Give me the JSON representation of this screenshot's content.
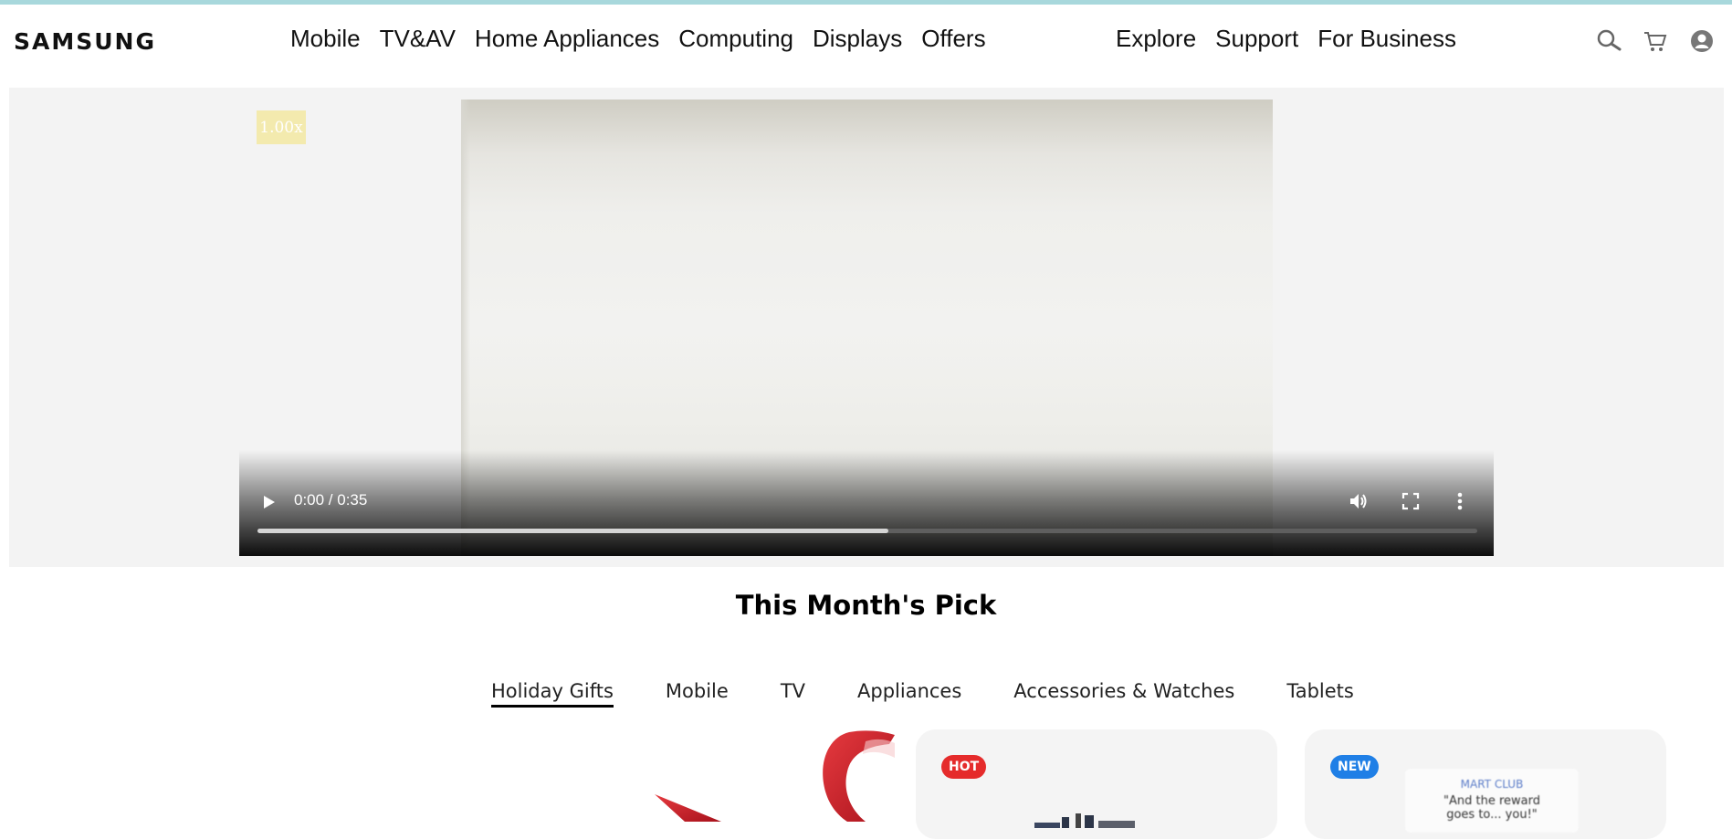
{
  "brand": {
    "logo_text": "SAMSUNG"
  },
  "nav": {
    "primary": [
      "Mobile",
      "TV&AV",
      "Home Appliances",
      "Computing",
      "Displays",
      "Offers"
    ],
    "secondary": [
      "Explore",
      "Support",
      "For Business"
    ]
  },
  "header_icons": [
    "search-icon",
    "cart-icon",
    "account-icon"
  ],
  "video": {
    "speed_label": "1.00x",
    "time_label": "0:00 / 0:35",
    "progress_fraction": 0.517
  },
  "section": {
    "title": "This Month's Pick",
    "tabs": [
      "Holiday Gifts",
      "Mobile",
      "TV",
      "Appliances",
      "Accessories & Watches",
      "Tablets"
    ],
    "active_tab": "Holiday Gifts"
  },
  "cards": [
    {
      "badge": "HOT",
      "badge_color": "#e52b2b"
    },
    {
      "badge": "NEW",
      "badge_color": "#1f7fe6",
      "promo_club": "MART CLUB",
      "promo_quote_1": "\"And the reward",
      "promo_quote_2": "goes to... you!\""
    }
  ],
  "colors": {
    "top_line": "#a8d8dc",
    "hero_bg": "#f3f3f3",
    "card_bg": "#f4f4f4",
    "ribbon": "#d0202a"
  }
}
